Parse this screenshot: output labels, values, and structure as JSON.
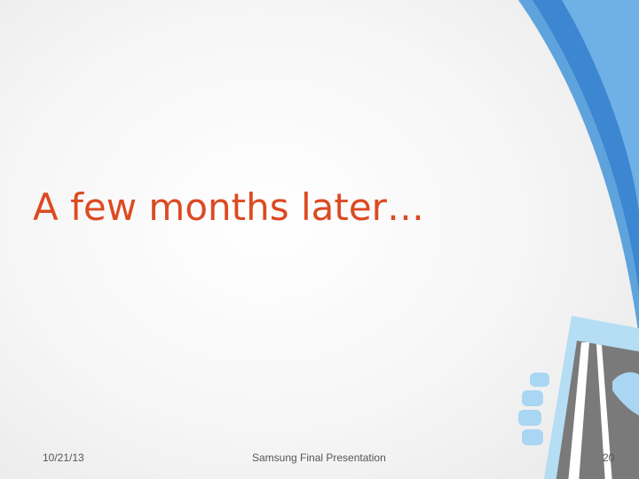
{
  "slide": {
    "title": "A few months later…",
    "footer": {
      "date": "10/21/13",
      "center_text": "Samsung Final Presentation",
      "page_number": "20"
    },
    "colors": {
      "title": "#dc4a22",
      "accent_blue": "#4a90d9",
      "accent_light_blue": "#a9d6f2",
      "phone_screen": "#7a7a7a"
    },
    "icons": [
      "hand-holding-phone-icon"
    ]
  }
}
